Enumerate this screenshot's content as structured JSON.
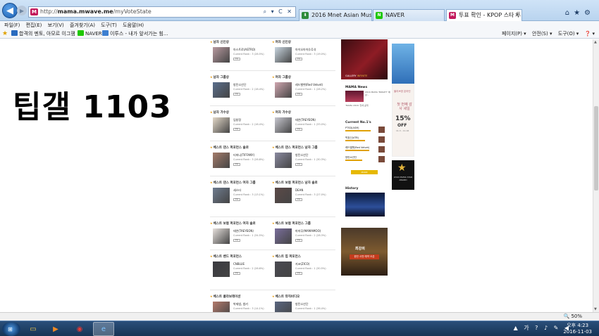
{
  "browser": {
    "url_prefix": "http://",
    "url_host": "mama.mwave.me",
    "url_path": "/myVoteState",
    "url_tools": "⌕ ▾ C ✕",
    "tabs": [
      {
        "label": "2016 Mnet Asian Music Awar...",
        "icon_color": "#2e8b3a"
      },
      {
        "label": "NAVER",
        "icon_color": "#1ec800"
      },
      {
        "label": "투표 확인 - KPOP 스타 투...",
        "icon_color": "#c2185b"
      }
    ],
    "tab_close": "✕",
    "window_controls": [
      "⌂",
      "★",
      "⚙"
    ]
  },
  "menu": {
    "items": [
      "파일(F)",
      "편집(E)",
      "보기(V)",
      "즐겨찾기(A)",
      "도구(T)",
      "도움말(H)"
    ]
  },
  "favorites": {
    "items": [
      "합격의 멘토, 아모르 이그잼",
      "NAVER",
      "이투스 - 내가 앞서가는 힘..."
    ],
    "commands": [
      "페이지(P) ▾",
      "안전(S) ▾",
      "도구(O) ▾",
      "❓ ▾"
    ]
  },
  "page": {
    "big_title": "팁갤 1103",
    "categories": [
      {
        "title": "남자 신인상",
        "candidate": "아스트로(ASTRO)",
        "current": "Current Rank : 3 (26.5%)",
        "col": 0
      },
      {
        "title": "여자 신인상",
        "candidate": "아이오아이(I.O.I)",
        "current": "Current Rank : 3 (19.0%)",
        "col": 1
      },
      {
        "title": "남자 그룹상",
        "candidate": "방탄소년단",
        "current": "Current Rank : 2 (16.4%)",
        "col": 0
      },
      {
        "title": "여자 그룹상",
        "candidate": "레드벨벳(Red Velvet)",
        "current": "Current Rank : 1 (28.2%)",
        "col": 1
      },
      {
        "title": "남자 가수상",
        "candidate": "임창정",
        "current": "Current Rank : 2 (16.4%)",
        "col": 0
      },
      {
        "title": "여자 가수상",
        "candidate": "태연(TAEYEON)",
        "current": "Current Rank : 1 (33.0%)",
        "col": 1
      },
      {
        "title": "베스트 댄스 퍼포먼스 솔로",
        "candidate": "티파니(TIFFANY)",
        "current": "Current Rank : 3 (26.8%)",
        "col": 0
      },
      {
        "title": "베스트 댄스 퍼포먼스 남자 그룹",
        "candidate": "방탄소년단",
        "current": "Current Rank : 1 (30.3%)",
        "col": 1
      },
      {
        "title": "베스트 댄스 퍼포먼스 여자 그룹",
        "candidate": "세스타",
        "current": "Current Rank : 3 (13.1%)",
        "col": 0
      },
      {
        "title": "베스트 보컬 퍼포먼스 남자 솔로",
        "candidate": "DEAN",
        "current": "Current Rank : 3 (27.0%)",
        "col": 1
      },
      {
        "title": "베스트 보컬 퍼포먼스 여자 솔로",
        "candidate": "태연(TAEYEON)",
        "current": "Current Rank : 1 (34.5%)",
        "col": 0
      },
      {
        "title": "베스트 보컬 퍼포먼스 그룹",
        "candidate": "마마무(MAMAMOO)",
        "current": "Current Rank : 2 (28.3%)",
        "col": 1
      },
      {
        "title": "베스트 밴드 퍼포먼스",
        "candidate": "CNBLUE",
        "current": "Current Rank : 2 (26.6%)",
        "col": 0
      },
      {
        "title": "베스트 힙 퍼포먼스",
        "candidate": "지코(ZICO)",
        "current": "Current Rank : 1 (30.5%)",
        "col": 1
      },
      {
        "title": "베스트 콜라보레이션",
        "candidate": "박재범, 범키",
        "current": "Current Rank : 3 (14.1%)",
        "col": 0
      },
      {
        "title": "베스트 뮤직비디오",
        "candidate": "방탄소년단",
        "current": "Current Rank : 1 (36.4%)",
        "col": 1
      }
    ],
    "vote_label": "투표",
    "sidebar": {
      "top_ad_label": "GALLERY",
      "top_ad_label2": "INFINITE",
      "news_title": "MAMA News",
      "news_text": "2016 MAMA 'BRIGHT' 예상...",
      "news_text2": "'MAMA 2016' 전세 공개",
      "current_title": "Current No.1's",
      "current_rows": [
        {
          "name": "PTSD(ASM)",
          "pct": 0.9
        },
        {
          "name": "박효신(ATB)",
          "pct": 0.7
        },
        {
          "name": "레드벨벳(Red Velvet)",
          "pct": 0.85
        },
        {
          "name": "방탄소년단",
          "pct": 0.6
        }
      ],
      "more_label": "MORE",
      "history_title": "History",
      "game_line1": "최강의",
      "game_line2": "완전 사전 예약 오픈"
    },
    "right_ads": {
      "sale_brand": "올리브영 온라인",
      "sale_copy": "첫 번째 감사 세일",
      "sale_percent": "15%",
      "sale_off": "OFF",
      "sale_date": "11.3 - 11.16",
      "mama_text": "2016 MAMA STAR AWARD"
    },
    "zoom_label": "🔍 50%"
  },
  "taskbar": {
    "clock_time": "오후 4:23",
    "clock_date": "2016-11-03",
    "tray_icons": "▲ 가 ? ♪ ✎ ◀"
  }
}
